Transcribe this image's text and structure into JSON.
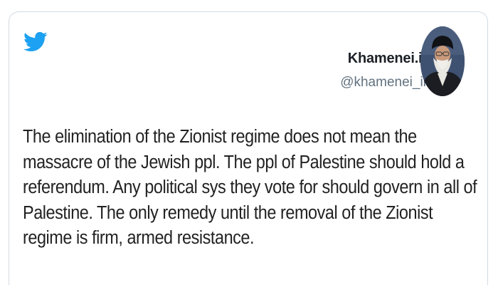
{
  "tweet": {
    "author_name": "Khamenei.ir",
    "author_handle": "@khamenei_ir",
    "text": "The elimination of the Zionist regime does not mean the massacre of the Jewish ppl. The ppl of Palestine should hold a referendum. Any political sys they vote for should govern in all of Palestine. The only remedy until the removal of the Zionist regime is firm, armed resistance."
  },
  "icons": {
    "logo": "twitter-bird-icon",
    "avatar": "profile-photo"
  },
  "colors": {
    "twitter_blue": "#1da1f2",
    "text": "#222222",
    "handle": "#62727f",
    "border": "#d3dbe2"
  }
}
